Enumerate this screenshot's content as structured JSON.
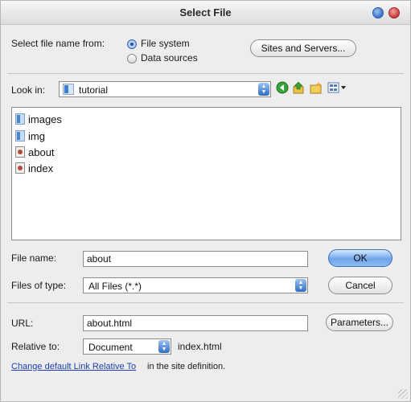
{
  "window": {
    "title": "Select File"
  },
  "source": {
    "label": "Select file name from:",
    "options": [
      {
        "label": "File system",
        "selected": true
      },
      {
        "label": "Data sources",
        "selected": false
      }
    ],
    "sites_button": "Sites and Servers..."
  },
  "look_in": {
    "label": "Look in:",
    "value": "tutorial",
    "icons": [
      "back-icon",
      "up-folder-icon",
      "new-folder-icon",
      "view-menu-icon"
    ]
  },
  "files": [
    {
      "name": "images",
      "kind": "folder"
    },
    {
      "name": "img",
      "kind": "folder"
    },
    {
      "name": "about",
      "kind": "file"
    },
    {
      "name": "index",
      "kind": "file"
    }
  ],
  "file_name": {
    "label": "File name:",
    "value": "about"
  },
  "file_type": {
    "label": "Files of type:",
    "value": "All Files (*.*)"
  },
  "buttons": {
    "ok": "OK",
    "cancel": "Cancel",
    "parameters": "Parameters..."
  },
  "url": {
    "label": "URL:",
    "value": "about.html"
  },
  "relative": {
    "label": "Relative to:",
    "value": "Document",
    "file": "index.html"
  },
  "footer": {
    "link": "Change default Link Relative To",
    "rest": " in the site definition."
  },
  "colors": {
    "primary_button": "#6ea4e8",
    "link": "#1b3fb0",
    "dialog_bg": "#ededed"
  }
}
